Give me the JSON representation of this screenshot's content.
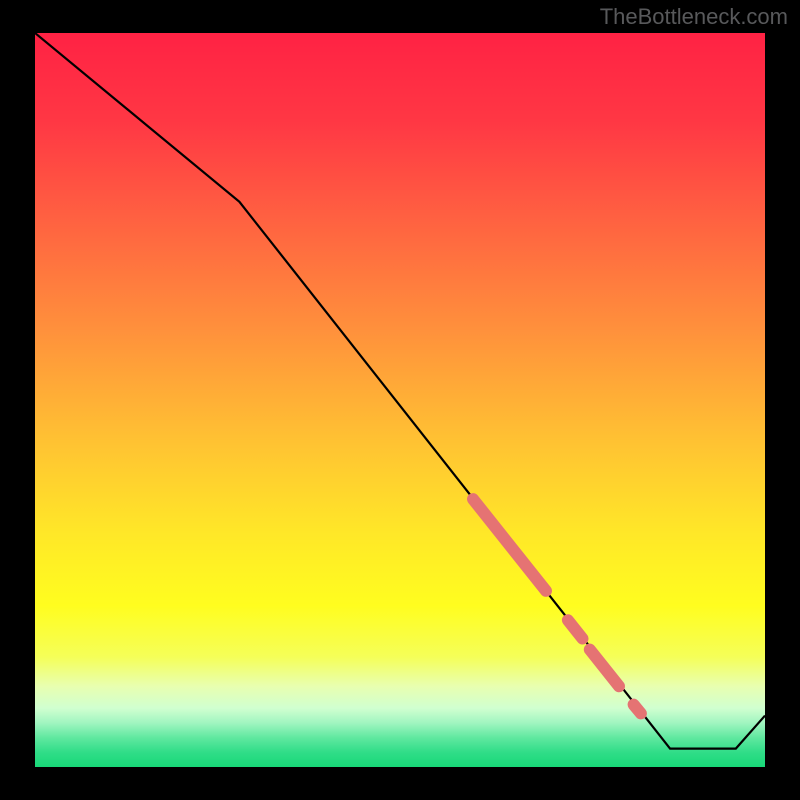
{
  "watermark": "TheBottleneck.com",
  "chart_data": {
    "type": "line",
    "title": "",
    "xlabel": "",
    "ylabel": "",
    "xlim": [
      0,
      100
    ],
    "ylim": [
      0,
      100
    ],
    "curve_points": [
      {
        "x": 0,
        "y": 100
      },
      {
        "x": 28,
        "y": 77
      },
      {
        "x": 87,
        "y": 2.5
      },
      {
        "x": 96,
        "y": 2.5
      },
      {
        "x": 100,
        "y": 7
      }
    ],
    "highlighted_segments": [
      {
        "x1": 60,
        "y1": 36.5,
        "x2": 70,
        "y2": 24
      },
      {
        "x1": 73,
        "y1": 20,
        "x2": 75,
        "y2": 17.5
      },
      {
        "x1": 76,
        "y1": 16,
        "x2": 80,
        "y2": 11
      },
      {
        "x1": 82,
        "y1": 8.5,
        "x2": 83,
        "y2": 7.3
      }
    ],
    "gradient_stops": [
      {
        "offset": 0,
        "color": "#ff2244"
      },
      {
        "offset": 12,
        "color": "#ff3744"
      },
      {
        "offset": 25,
        "color": "#ff6041"
      },
      {
        "offset": 40,
        "color": "#ff8f3c"
      },
      {
        "offset": 55,
        "color": "#ffc033"
      },
      {
        "offset": 68,
        "color": "#ffe728"
      },
      {
        "offset": 78,
        "color": "#fffd1f"
      },
      {
        "offset": 85,
        "color": "#f5ff58"
      },
      {
        "offset": 89,
        "color": "#e8ffb0"
      },
      {
        "offset": 92,
        "color": "#d0ffd0"
      },
      {
        "offset": 94,
        "color": "#a0f5c0"
      },
      {
        "offset": 96,
        "color": "#60e8a0"
      },
      {
        "offset": 98,
        "color": "#30dd88"
      },
      {
        "offset": 100,
        "color": "#18d878"
      }
    ],
    "highlight_color": "#e57373",
    "curve_color": "#000000"
  }
}
